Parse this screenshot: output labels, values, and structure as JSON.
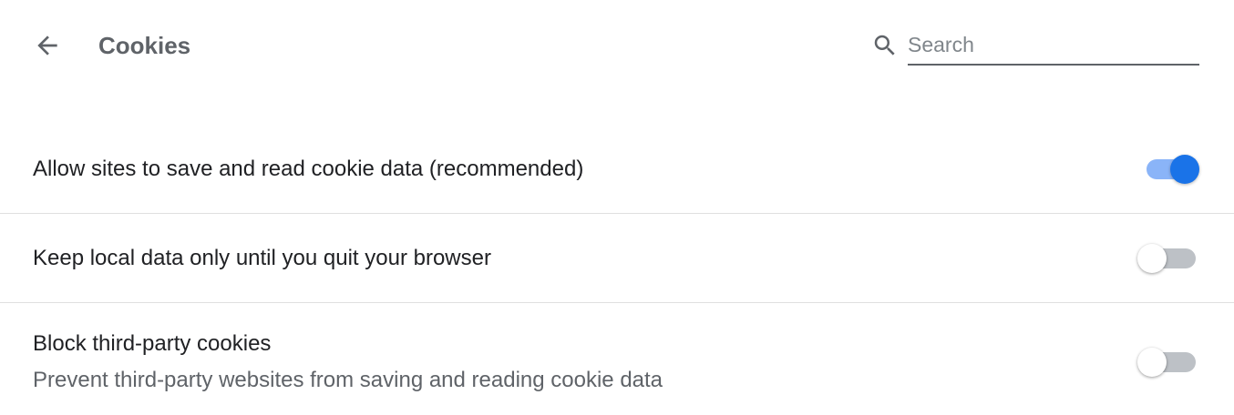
{
  "header": {
    "title": "Cookies",
    "back_icon": "arrow-left-icon",
    "search_icon": "search-icon",
    "search_placeholder": "Search",
    "search_value": ""
  },
  "settings": [
    {
      "label": "Allow sites to save and read cookie data (recommended)",
      "sublabel": "",
      "enabled": true
    },
    {
      "label": "Keep local data only until you quit your browser",
      "sublabel": "",
      "enabled": false
    },
    {
      "label": "Block third-party cookies",
      "sublabel": "Prevent third-party websites from saving and reading cookie data",
      "enabled": false
    }
  ],
  "colors": {
    "accent": "#1a73e8",
    "accent_track": "#8ab4f8",
    "off_track": "#bdc1c6",
    "text_primary": "#202124",
    "text_secondary": "#5f6368"
  }
}
